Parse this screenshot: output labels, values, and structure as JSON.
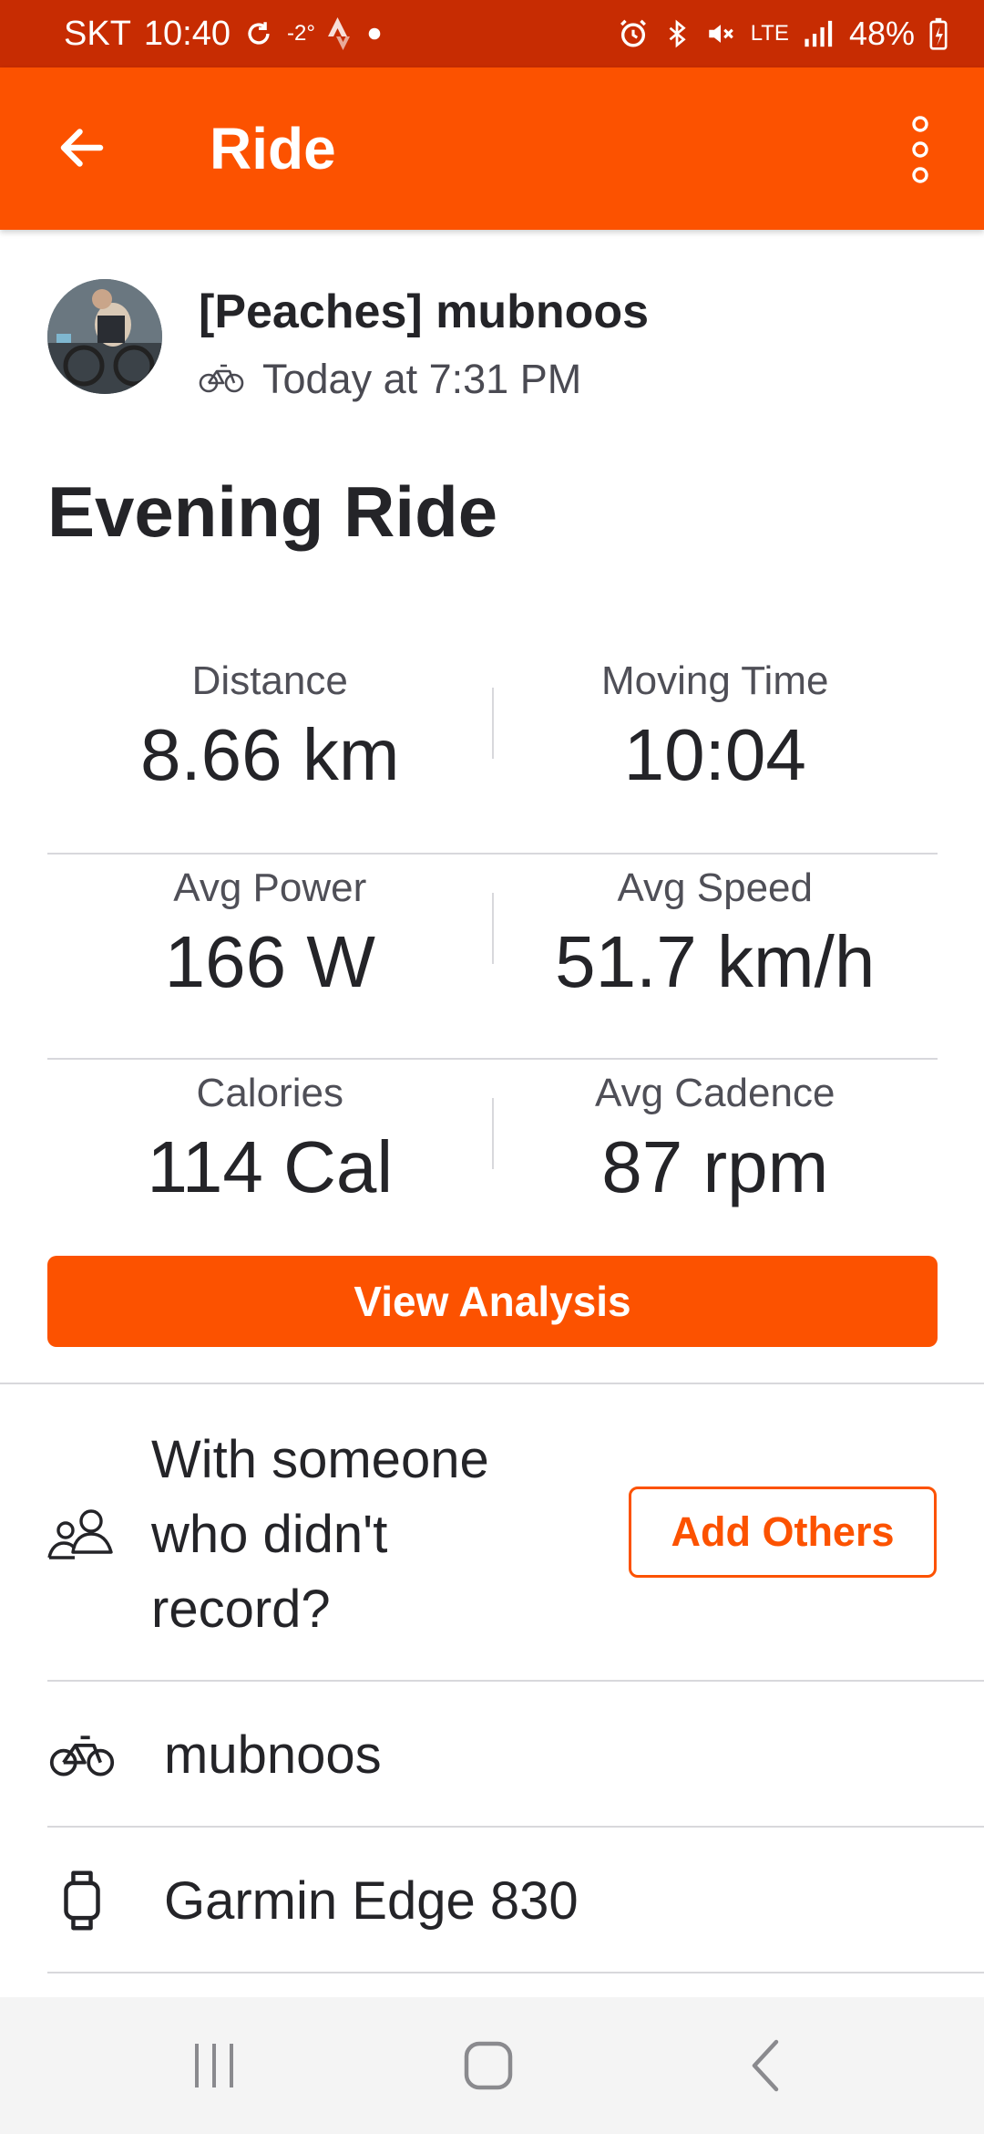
{
  "status_bar": {
    "carrier": "SKT",
    "time": "10:40",
    "temperature": "-2°",
    "battery": "48%",
    "network": "LTE"
  },
  "app_bar": {
    "title": "Ride"
  },
  "athlete": {
    "name": "[Peaches] mubnoos",
    "date": "Today at 7:31 PM"
  },
  "activity": {
    "title": "Evening Ride"
  },
  "stats": [
    {
      "label": "Distance",
      "value": "8.66 km"
    },
    {
      "label": "Moving Time",
      "value": "10:04"
    },
    {
      "label": "Avg Power",
      "value": "166 W"
    },
    {
      "label": "Avg Speed",
      "value": "51.7 km/h"
    },
    {
      "label": "Calories",
      "value": "114 Cal"
    },
    {
      "label": "Avg Cadence",
      "value": "87 rpm"
    }
  ],
  "buttons": {
    "view_analysis": "View Analysis",
    "add_others": "Add Others"
  },
  "with_someone": {
    "line1": "With someone",
    "line2": "who didn't",
    "line3": "record?"
  },
  "details": {
    "bike": "mubnoos",
    "device": "Garmin Edge 830"
  },
  "colors": {
    "brand": "#fc5200",
    "status_bar": "#c72c02"
  }
}
